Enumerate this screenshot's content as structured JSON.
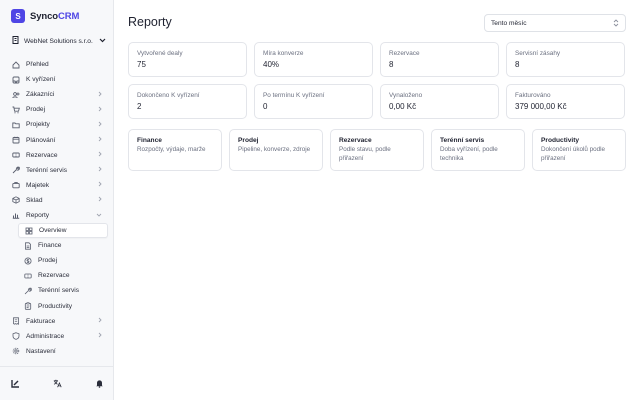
{
  "app": {
    "logo_letter": "S",
    "name_part1": "Synco",
    "name_part2": "CRM",
    "brand_color": "#4f46e5"
  },
  "org": {
    "name": "WebNet Solutions s.r.o."
  },
  "sidebar": {
    "items": [
      {
        "label": "Přehled",
        "icon": "home-icon"
      },
      {
        "label": "K vyřízení",
        "icon": "inbox-icon"
      },
      {
        "label": "Zákazníci",
        "icon": "users-icon",
        "expandable": true
      },
      {
        "label": "Prodej",
        "icon": "cart-icon",
        "expandable": true
      },
      {
        "label": "Projekty",
        "icon": "folder-icon",
        "expandable": true
      },
      {
        "label": "Plánování",
        "icon": "calendar-icon",
        "expandable": true
      },
      {
        "label": "Rezervace",
        "icon": "ticket-icon",
        "expandable": true
      },
      {
        "label": "Terénní servis",
        "icon": "wrench-icon",
        "expandable": true
      },
      {
        "label": "Majetek",
        "icon": "briefcase-icon",
        "expandable": true
      },
      {
        "label": "Sklad",
        "icon": "box-icon",
        "expandable": true
      },
      {
        "label": "Reporty",
        "icon": "chart-icon",
        "expandable": true,
        "expanded": true
      }
    ],
    "reports_sub": [
      {
        "label": "Overview",
        "icon": "grid-icon",
        "active": true
      },
      {
        "label": "Finance",
        "icon": "file-icon"
      },
      {
        "label": "Prodej",
        "icon": "dollar-icon"
      },
      {
        "label": "Rezervace",
        "icon": "ticket-icon"
      },
      {
        "label": "Terénní servis",
        "icon": "wrench-icon"
      },
      {
        "label": "Productivity",
        "icon": "clipboard-icon"
      }
    ],
    "bottom_items": [
      {
        "label": "Fakturace",
        "icon": "receipt-icon",
        "expandable": true
      },
      {
        "label": "Administrace",
        "icon": "shield-icon",
        "expandable": true
      },
      {
        "label": "Nastavení",
        "icon": "gear-icon"
      }
    ],
    "footer": [
      "sidebar-toggle-icon",
      "language-icon",
      "bell-icon"
    ]
  },
  "page": {
    "title": "Reporty",
    "period": "Tento měsíc"
  },
  "kpis": [
    {
      "label": "Vytvořené dealy",
      "value": "75"
    },
    {
      "label": "Míra konverze",
      "value": "40%"
    },
    {
      "label": "Rezervace",
      "value": "8"
    },
    {
      "label": "Servisní zásahy",
      "value": "8"
    },
    {
      "label": "Dokončeno K vyřízení",
      "value": "2"
    },
    {
      "label": "Po termínu K vyřízení",
      "value": "0"
    },
    {
      "label": "Vynaloženo",
      "value": "0,00 Kč"
    },
    {
      "label": "Fakturováno",
      "value": "379 000,00 Kč"
    }
  ],
  "reports": [
    {
      "title": "Finance",
      "desc": "Rozpočty, výdaje, marže"
    },
    {
      "title": "Prodej",
      "desc": "Pipeline, konverze, zdroje"
    },
    {
      "title": "Rezervace",
      "desc": "Podle stavu, podle přiřazení"
    },
    {
      "title": "Terénní servis",
      "desc": "Doba vyřízení, podle technika"
    },
    {
      "title": "Productivity",
      "desc": "Dokončení úkolů podle přiřazení"
    }
  ]
}
